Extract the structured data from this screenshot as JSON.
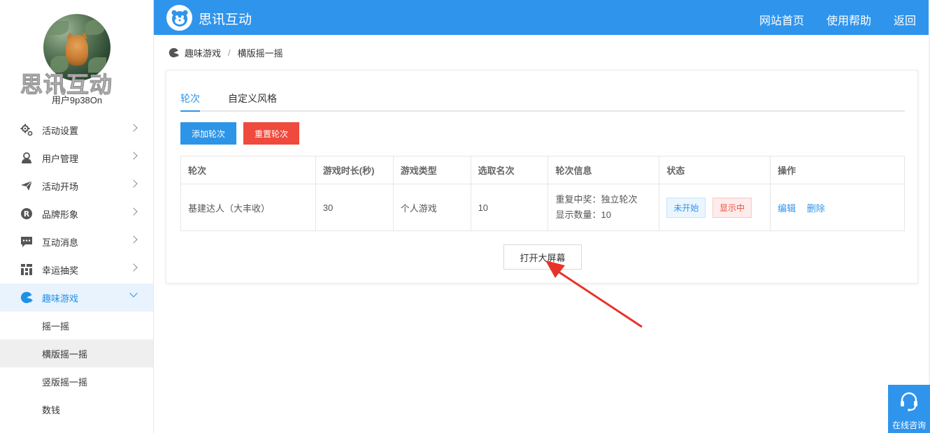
{
  "sidebar": {
    "brand_watermark": "思讯互动",
    "username": "用户9p38On",
    "menu": [
      {
        "label": "活动设置",
        "icon": "gear-icon"
      },
      {
        "label": "用户管理",
        "icon": "user-icon"
      },
      {
        "label": "活动开场",
        "icon": "paper-plane-icon"
      },
      {
        "label": "品牌形象",
        "icon": "registered-icon"
      },
      {
        "label": "互动消息",
        "icon": "message-icon"
      },
      {
        "label": "幸运抽奖",
        "icon": "grid-icon"
      },
      {
        "label": "趣味游戏",
        "icon": "game-icon",
        "active": true
      }
    ],
    "submenu": [
      {
        "label": "摇一摇"
      },
      {
        "label": "横版摇一摇",
        "selected": true
      },
      {
        "label": "竖版摇一摇"
      },
      {
        "label": "数钱"
      }
    ]
  },
  "header": {
    "title": "思讯互动",
    "nav": [
      "网站首页",
      "使用帮助",
      "返回"
    ]
  },
  "breadcrumb": [
    "趣味游戏",
    "横版摇一摇"
  ],
  "tabs": [
    "轮次",
    "自定义风格"
  ],
  "buttons": {
    "add_round": "添加轮次",
    "reset_round": "重置轮次",
    "open_screen": "打开大屏幕"
  },
  "table": {
    "headers": [
      "轮次",
      "游戏时长(秒)",
      "游戏类型",
      "选取名次",
      "轮次信息",
      "状态",
      "操作"
    ],
    "rows": [
      {
        "round": "基建达人（大丰收）",
        "duration": "30",
        "type": "个人游戏",
        "rank": "10",
        "info_line1": "重复中奖：独立轮次",
        "info_line2": "显示数量：10",
        "status1": "未开始",
        "status2": "显示中",
        "op_edit": "编辑",
        "op_delete": "删除"
      }
    ]
  },
  "consult": {
    "label": "在线咨询"
  },
  "colors": {
    "primary": "#2f94ec",
    "danger": "#ef4a3c",
    "annotation_arrow": "#e8332a"
  }
}
